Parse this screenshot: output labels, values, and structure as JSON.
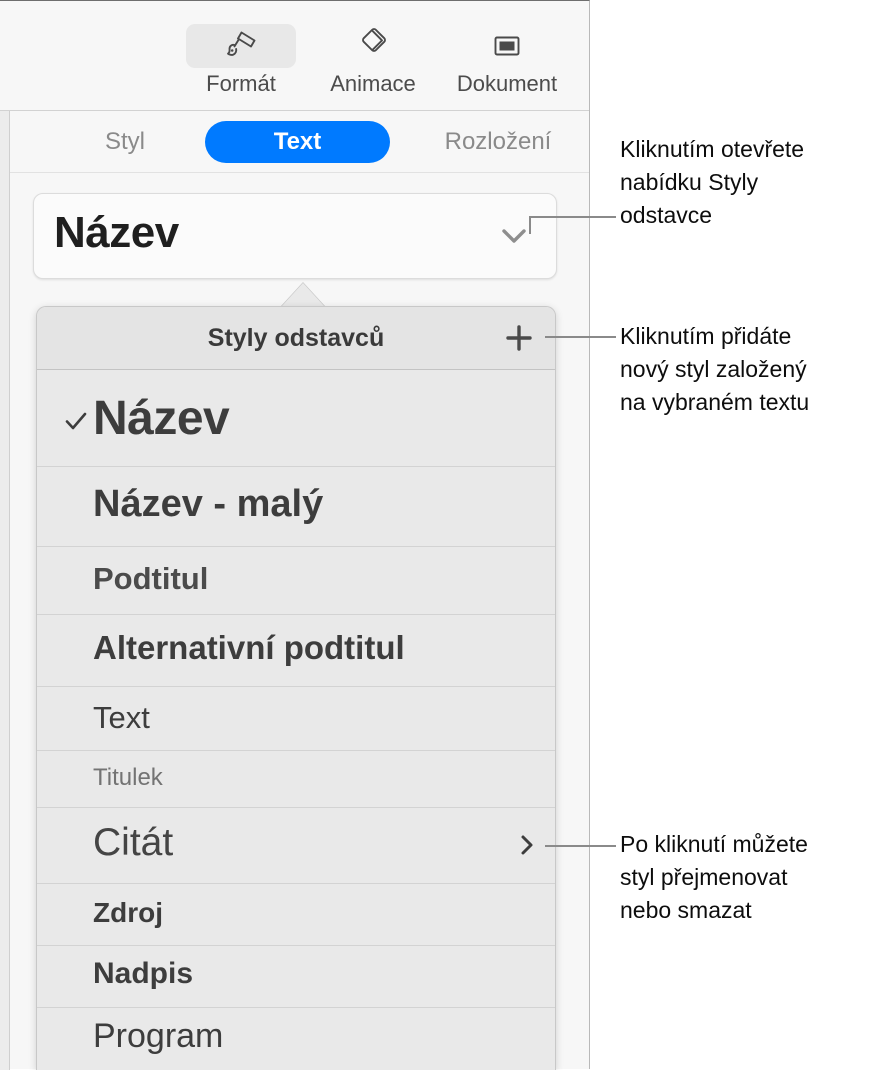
{
  "toolbar": {
    "items": [
      {
        "label": "Formát",
        "icon": "paintbrush-icon",
        "selected": true
      },
      {
        "label": "Animace",
        "icon": "animate-diamonds-icon",
        "selected": false
      },
      {
        "label": "Dokument",
        "icon": "document-icon",
        "selected": false
      }
    ]
  },
  "tabs": {
    "items": [
      {
        "label": "Styl",
        "active": false
      },
      {
        "label": "Text",
        "active": true
      },
      {
        "label": "Rozložení",
        "active": false
      }
    ],
    "active_color": "#007aff"
  },
  "style_button": {
    "value": "Název",
    "chevron_icon": "chevron-down-icon"
  },
  "dropdown": {
    "title": "Styly odstavců",
    "add_icon": "plus-icon",
    "check_icon": "checkmark-icon",
    "submenu_icon": "chevron-right-icon",
    "rows": [
      {
        "label": "Název",
        "checked": true,
        "submenu": false
      },
      {
        "label": "Název - malý",
        "checked": false,
        "submenu": false
      },
      {
        "label": "Podtitul",
        "checked": false,
        "submenu": false
      },
      {
        "label": "Alternativní podtitul",
        "checked": false,
        "submenu": false
      },
      {
        "label": "Text",
        "checked": false,
        "submenu": false
      },
      {
        "label": "Titulek",
        "checked": false,
        "submenu": false
      },
      {
        "label": "Citát",
        "checked": false,
        "submenu": true
      },
      {
        "label": "Zdroj",
        "checked": false,
        "submenu": false
      },
      {
        "label": "Nadpis",
        "checked": false,
        "submenu": false
      },
      {
        "label": "Program",
        "checked": false,
        "submenu": false
      }
    ]
  },
  "callouts": [
    {
      "text": "Kliknutím otevřete\nnabídku Styly\nodstavce"
    },
    {
      "text": "Kliknutím přidáte\nnový styl založený\nna vybraném textu"
    },
    {
      "text": "Po kliknutí můžete\nstyl přejmenovat\nnebo smazat"
    }
  ]
}
